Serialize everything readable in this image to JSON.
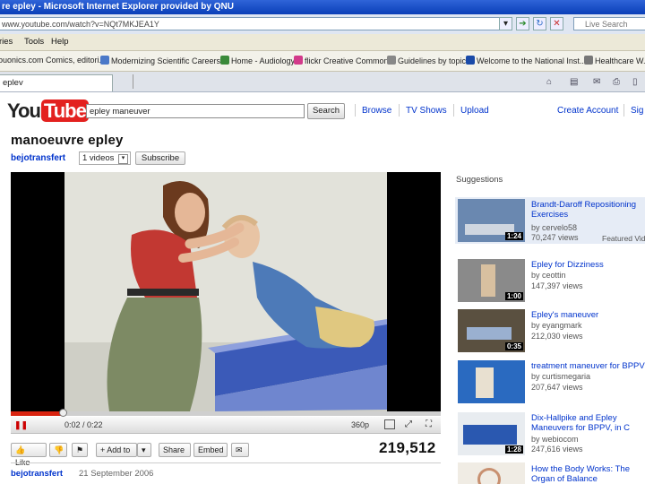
{
  "window": {
    "title": "re epley - Microsoft Internet Explorer provided by QNU"
  },
  "address": {
    "url": "www.youtube.com/watch?v=NQt7MKJEA1Y",
    "live_search_placeholder": "Live Search"
  },
  "menu": [
    "ries",
    "Tools",
    "Help"
  ],
  "favorites": [
    {
      "label": "ouonics.com Comics, editori...",
      "color": "#8b6a3a"
    },
    {
      "label": "Modernizing Scientific Careers...",
      "color": "#4a78c8"
    },
    {
      "label": "Home - Audiology",
      "color": "#3a8a3a"
    },
    {
      "label": "flickr Creative Commons",
      "color": "#d23a8a"
    },
    {
      "label": "Guidelines by topic",
      "color": "#888888"
    },
    {
      "label": "Welcome to the National Inst...",
      "color": "#1a4aa8"
    },
    {
      "label": "Healthcare W...",
      "color": "#777777"
    }
  ],
  "tab": {
    "label": "eplev"
  },
  "youtube": {
    "logo_you": "You",
    "logo_tube": "Tube",
    "search_value": "epley maneuver",
    "search_button": "Search",
    "nav": [
      "Browse",
      "TV Shows",
      "Upload",
      "Create Account",
      "Sig"
    ],
    "video_title": "manoeuvre epley",
    "channel": "bejotransfert",
    "videos_dropdown": "1 videos",
    "subscribe": "Subscribe",
    "time": "0:02 / 0:22",
    "quality": "360p",
    "progress_fraction": 0.12,
    "actions": {
      "like": "Like",
      "add_to": "Add to",
      "share": "Share",
      "embed": "Embed"
    },
    "view_count": "219,512",
    "uploader": "bejotransfert",
    "upload_date": "21 September 2006",
    "suggestions_label": "Suggestions",
    "suggestions": [
      {
        "title": "Brandt-Daroff Repositioning Exercises",
        "by": "by cervelo58",
        "views": "70,247 views",
        "duration": "1:24",
        "featured": "Featured Video"
      },
      {
        "title": "Epley for Dizziness",
        "by": "by ceottin",
        "views": "147,397 views",
        "duration": "1:00"
      },
      {
        "title": "Epley's maneuver",
        "by": "by eyangmark",
        "views": "212,030 views",
        "duration": "0:35"
      },
      {
        "title": "treatment maneuver for BPPV",
        "by": "by curtismegaria",
        "views": "207,647 views",
        "duration": ""
      },
      {
        "title": "Dix-Hallpike and Epley Maneuvers for BPPV, in C",
        "by": "by webiocom",
        "views": "247,616 views",
        "duration": "1:28"
      },
      {
        "title": "How the Body Works: The Organ of Balance",
        "by": "",
        "views": "",
        "duration": ""
      }
    ]
  }
}
